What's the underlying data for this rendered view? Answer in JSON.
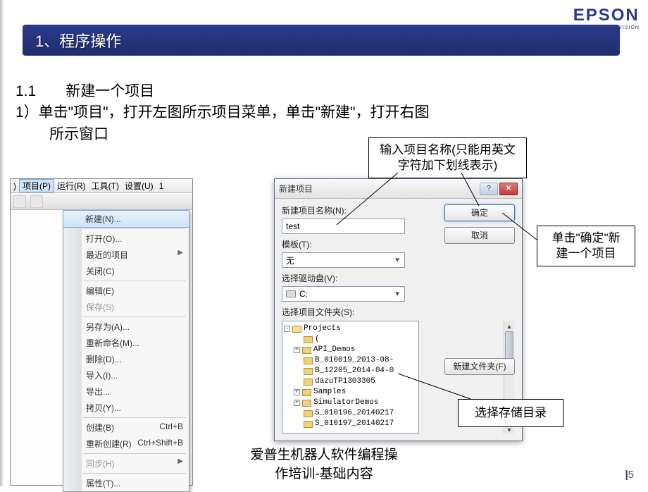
{
  "logo": {
    "main": "EPSON",
    "sub": "EXCEED YOUR VISION"
  },
  "title": "1、程序操作",
  "body": {
    "l1": "1.1　　新建一个项目",
    "l2": "1）单击\"项目\"，打开左图所示项目菜单，单击\"新建\"，打开右图",
    "l3": "所示窗口"
  },
  "menubar": {
    "left_frag": ")",
    "items": [
      "项目(P)",
      "运行(R)",
      "工具(T)",
      "设置(U)"
    ],
    "right_frag": "1"
  },
  "menu": {
    "items": [
      {
        "label": "新建(N)...",
        "sel": true
      },
      {
        "label": "打开(O)..."
      },
      {
        "label": "最近的项目",
        "submenu": true
      },
      {
        "label": "关闭(C)"
      },
      {
        "label": "编辑(E)"
      },
      {
        "label": "保存(S)",
        "dis": true
      },
      {
        "label": "另存为(A)..."
      },
      {
        "label": "重新命名(M)..."
      },
      {
        "label": "删除(D)..."
      },
      {
        "label": "导入(I)..."
      },
      {
        "label": "导出..."
      },
      {
        "label": "拷贝(Y)..."
      },
      {
        "label": "创建(B)",
        "shortcut": "Ctrl+B"
      },
      {
        "label": "重新创建(R)",
        "shortcut": "Ctrl+Shift+B"
      },
      {
        "label": "同步(H)",
        "dis": true,
        "submenu": true
      },
      {
        "label": "属性(T)..."
      }
    ],
    "separators_after": [
      0,
      3,
      5,
      11,
      13,
      14
    ]
  },
  "dialog": {
    "title": "新建项目",
    "labels": {
      "name": "新建项目名称(N):",
      "template": "模板(T):",
      "drive": "选择驱动盘(V):",
      "folder": "选择项目文件夹(S):"
    },
    "values": {
      "name": "test",
      "template": "无",
      "drive": "C:"
    },
    "buttons": {
      "ok": "确定",
      "cancel": "取消",
      "newfolder": "新建文件夹(F)"
    },
    "tree": [
      {
        "lvl": 0,
        "tog": "-",
        "open": true,
        "name": "Projects"
      },
      {
        "lvl": 1,
        "tog": "",
        "name": "("
      },
      {
        "lvl": 1,
        "tog": "+",
        "name": "API_Demos"
      },
      {
        "lvl": 1,
        "tog": "",
        "name": "B_010019_2013-08-"
      },
      {
        "lvl": 1,
        "tog": "",
        "name": "B_12205_2014-04-0"
      },
      {
        "lvl": 1,
        "tog": "",
        "name": "dazuTP1303305"
      },
      {
        "lvl": 1,
        "tog": "+",
        "name": "Samples"
      },
      {
        "lvl": 1,
        "tog": "+",
        "name": "SimulatorDemos"
      },
      {
        "lvl": 1,
        "tog": "",
        "name": "S_010196_20140217"
      },
      {
        "lvl": 1,
        "tog": "",
        "name": "S_010197_20140217"
      }
    ]
  },
  "callouts": {
    "name_hint_l1": "输入项目名称(只能用英文",
    "name_hint_l2": "字符加下划线表示)",
    "ok_hint_l1": "单击\"确定\"新",
    "ok_hint_l2": "建一个项目",
    "folder_hint": "选择存储目录"
  },
  "footer": {
    "l1": "爱普生机器人软件编程操",
    "l2": "作培训-基础内容"
  },
  "page": "5"
}
